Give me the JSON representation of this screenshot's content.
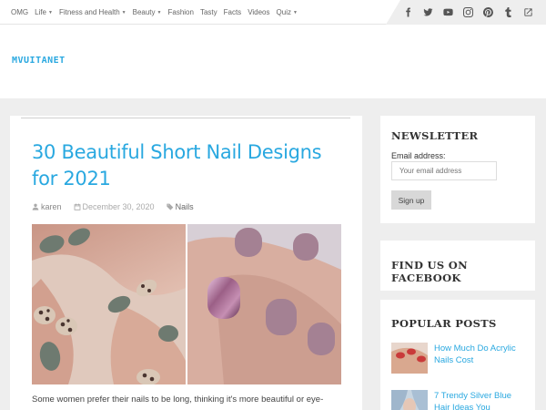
{
  "nav": {
    "items": [
      {
        "label": "OMG",
        "dropdown": false
      },
      {
        "label": "Life",
        "dropdown": true
      },
      {
        "label": "Fitness and Health",
        "dropdown": true
      },
      {
        "label": "Beauty",
        "dropdown": true
      },
      {
        "label": "Fashion",
        "dropdown": false
      },
      {
        "label": "Tasty",
        "dropdown": false
      },
      {
        "label": "Facts",
        "dropdown": false
      },
      {
        "label": "Videos",
        "dropdown": false
      },
      {
        "label": "Quiz",
        "dropdown": true
      }
    ],
    "social_icons": [
      "facebook-icon",
      "twitter-icon",
      "youtube-icon",
      "instagram-icon",
      "pinterest-icon",
      "tumblr-icon",
      "external-link-icon"
    ]
  },
  "header": {
    "logo_text": "MVUITANET"
  },
  "post": {
    "title": "30 Beautiful Short Nail Designs for 2021",
    "author": "karen",
    "date": "December 30, 2020",
    "category": "Nails",
    "excerpt": "Some women prefer their nails to be long, thinking it's more beautiful or eye-"
  },
  "sidebar": {
    "newsletter": {
      "title": "NEWSLETTER",
      "email_label": "Email address:",
      "email_placeholder": "Your email address",
      "button_label": "Sign up"
    },
    "facebook": {
      "title": "FIND US ON FACEBOOK"
    },
    "popular": {
      "title": "POPULAR POSTS",
      "items": [
        {
          "label": "How Much Do Acrylic Nails Cost"
        },
        {
          "label": "7 Trendy Silver Blue Hair Ideas You"
        }
      ]
    }
  },
  "colors": {
    "accent": "#29a8e0",
    "background": "#eeeeee"
  }
}
